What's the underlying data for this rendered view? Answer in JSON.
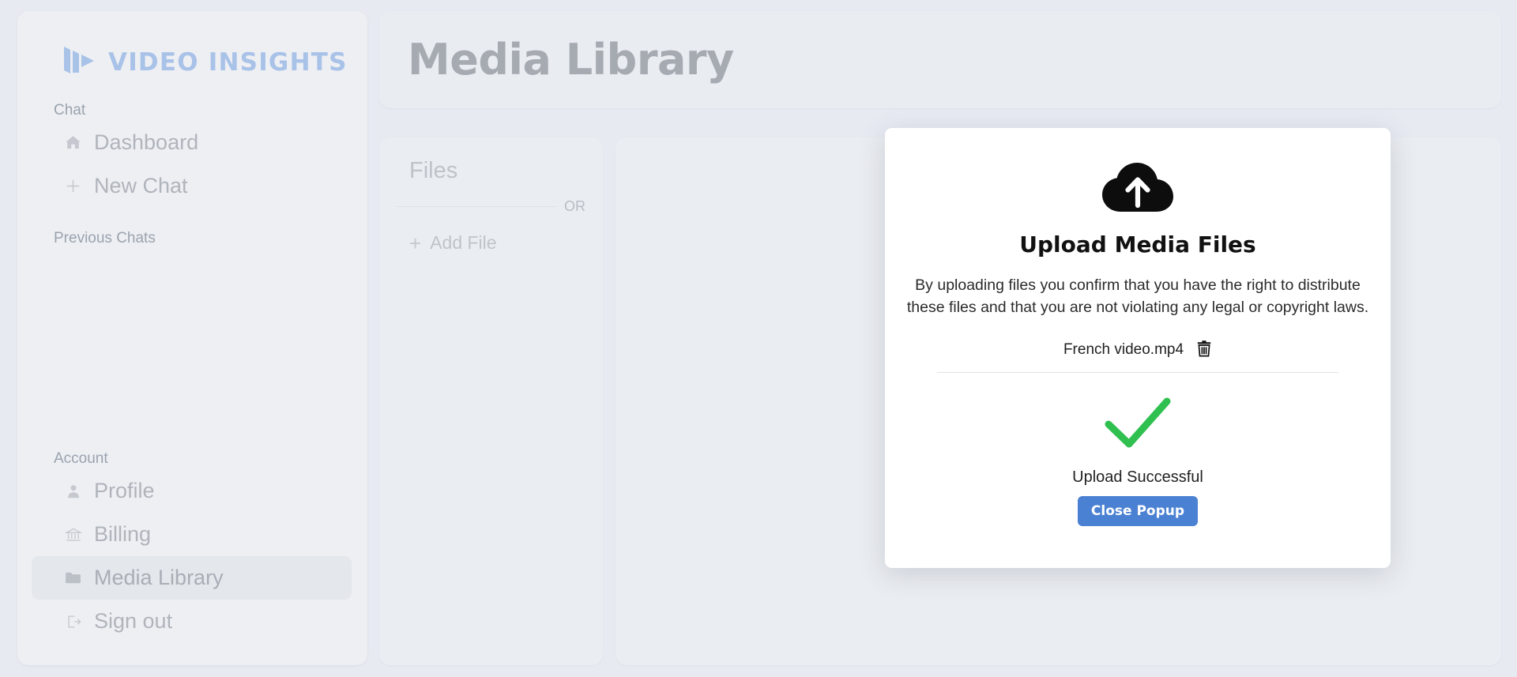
{
  "app": {
    "logo_text_primary": "VIDEO",
    "logo_text_secondary": "INSIGHTS",
    "logo_color": "#a9c2e8"
  },
  "sidebar": {
    "sections": [
      {
        "label": "Chat"
      },
      {
        "label": "Previous Chats"
      },
      {
        "label": "Account"
      }
    ],
    "chat_items": [
      {
        "label": "Dashboard",
        "icon": "home-icon"
      },
      {
        "label": "New Chat",
        "icon": "plus-icon"
      }
    ],
    "account_items": [
      {
        "label": "Profile",
        "icon": "user-icon"
      },
      {
        "label": "Billing",
        "icon": "bank-icon"
      },
      {
        "label": "Media Library",
        "icon": "folder-icon",
        "active": true
      },
      {
        "label": "Sign out",
        "icon": "logout-icon"
      }
    ]
  },
  "header": {
    "title": "Media Library"
  },
  "files_panel": {
    "title": "Files",
    "or_label": "OR",
    "add_file_label": "Add File",
    "add_file_icon": "plus-icon"
  },
  "modal": {
    "icon": "cloud-upload-icon",
    "title": "Upload Media Files",
    "description": "By uploading files you confirm that you have the right to distribute these files and that you are not violating any legal or copyright laws.",
    "files": [
      {
        "name": "French video.mp4",
        "delete_icon": "trash-icon"
      }
    ],
    "status_icon": "check-icon",
    "status_icon_color": "#2fc04f",
    "status_text": "Upload Successful",
    "close_label": "Close Popup",
    "close_button_color": "#4b81d3"
  }
}
